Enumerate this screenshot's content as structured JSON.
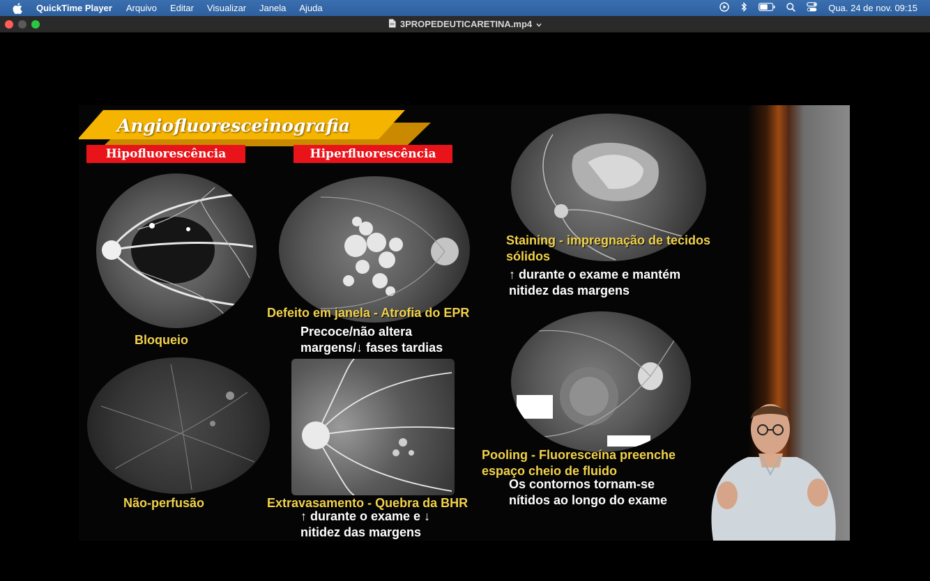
{
  "menubar": {
    "app_name": "QuickTime Player",
    "menus": [
      "Arquivo",
      "Editar",
      "Visualizar",
      "Janela",
      "Ajuda"
    ],
    "clock": "Qua. 24 de nov.  09:15",
    "icons": [
      "play-circle-icon",
      "bluetooth-icon",
      "battery-icon",
      "search-icon",
      "control-center-icon"
    ]
  },
  "window": {
    "title": "3PROPEDEUTICARETINA.mp4"
  },
  "slide": {
    "banner": "Angiofluoresceinografia",
    "col_hypo": "Hipofluorescência",
    "col_hyper": "Hiperfluorescência",
    "bloqueio": "Bloqueio",
    "nao_perfusao": "Não-perfusão",
    "defeito": "Defeito em janela - Atrofia do EPR",
    "defeito_desc_1": "Precoce/não altera",
    "defeito_desc_2": "margens/↓ fases tardias",
    "extravasamento": "Extravasamento - Quebra da BHR",
    "extrav_desc_1": "↑ durante o exame e ↓",
    "extrav_desc_2": "nitidez das margens",
    "staining_1": "Staining - impregnação de tecidos",
    "staining_2": "sólidos",
    "staining_desc_1": "↑ durante o exame e mantém",
    "staining_desc_2": "nitidez das margens",
    "pooling_1": "Pooling - Fluoresceína preenche",
    "pooling_2": "espaço cheio de fluido",
    "pooling_desc_1": "Os contornos tornam-se",
    "pooling_desc_2": "nítidos ao longo do exame"
  },
  "colors": {
    "banner_gold": "#f5b400",
    "label_red": "#e8141a",
    "caption_yellow": "#f2d24a",
    "menubar_blue": "#2d5f9e"
  }
}
